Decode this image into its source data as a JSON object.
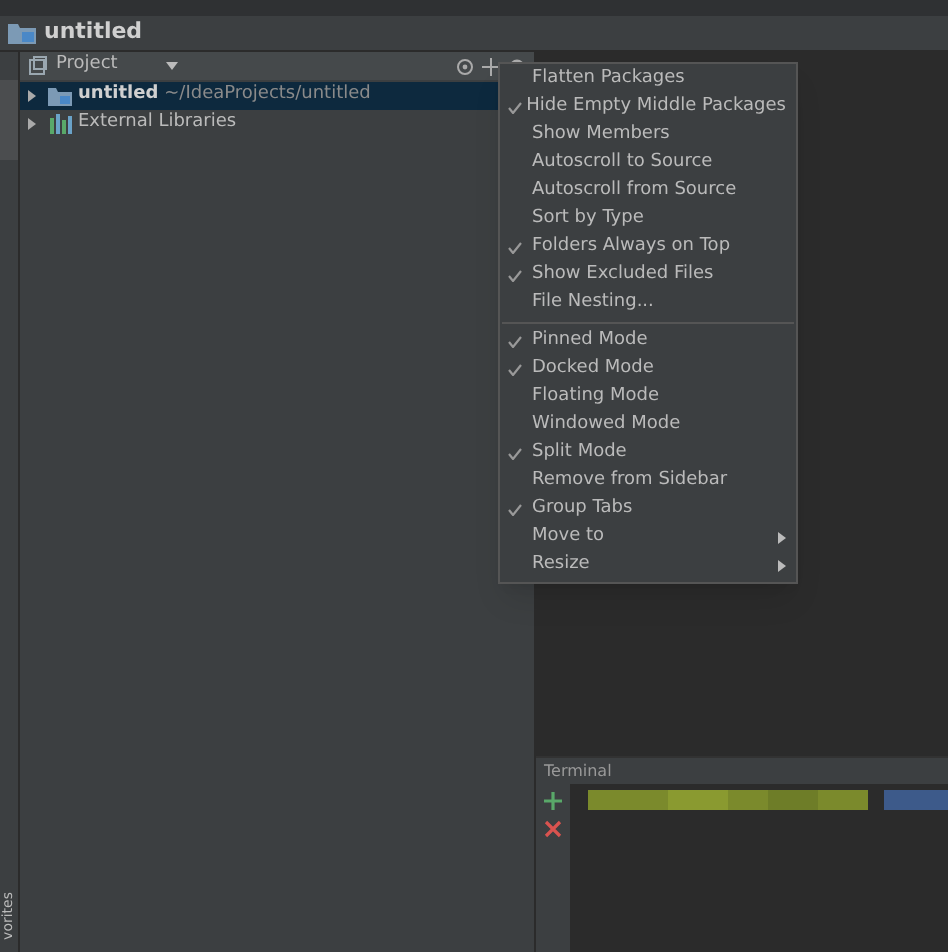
{
  "window": {
    "title": "untitled"
  },
  "side_strip": {
    "bottom_label": "vorites"
  },
  "project_panel": {
    "title": "Project",
    "tree": [
      {
        "label": "untitled",
        "path": "~/IdeaProjects/untitled",
        "kind": "module",
        "selected": true,
        "expanded": false
      },
      {
        "label": "External Libraries",
        "kind": "libraries",
        "selected": false,
        "expanded": false
      }
    ]
  },
  "context_menu": {
    "sections": [
      [
        {
          "label": "Flatten Packages",
          "checked": false
        },
        {
          "label": "Hide Empty Middle Packages",
          "checked": true
        },
        {
          "label": "Show Members",
          "checked": false
        },
        {
          "label": "Autoscroll to Source",
          "checked": false
        },
        {
          "label": "Autoscroll from Source",
          "checked": false
        },
        {
          "label": "Sort by Type",
          "checked": false
        },
        {
          "label": "Folders Always on Top",
          "checked": true
        },
        {
          "label": "Show Excluded Files",
          "checked": true
        },
        {
          "label": "File Nesting...",
          "checked": false
        }
      ],
      [
        {
          "label": "Pinned Mode",
          "checked": true
        },
        {
          "label": "Docked Mode",
          "checked": true
        },
        {
          "label": "Floating Mode",
          "checked": false
        },
        {
          "label": "Windowed Mode",
          "checked": false
        },
        {
          "label": "Split Mode",
          "checked": true
        },
        {
          "label": "Remove from Sidebar",
          "checked": false
        },
        {
          "label": "Group Tabs",
          "checked": true
        },
        {
          "label": "Move to",
          "checked": false,
          "submenu": true
        },
        {
          "label": "Resize",
          "checked": false,
          "submenu": true
        }
      ]
    ]
  },
  "terminal": {
    "title": "Terminal"
  }
}
